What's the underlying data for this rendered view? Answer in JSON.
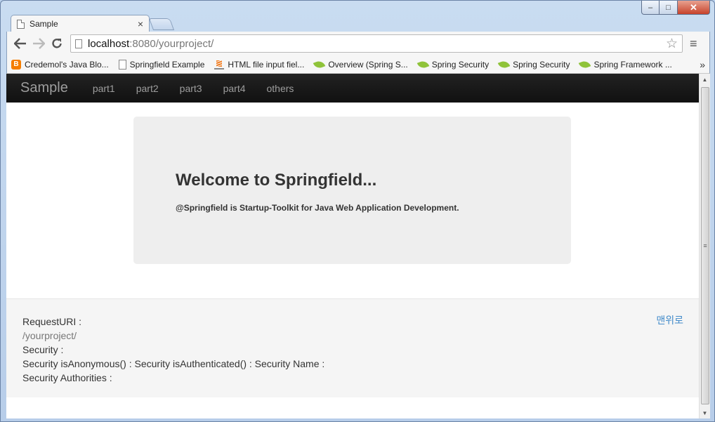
{
  "browser": {
    "tab_title": "Sample",
    "tab_close": "×",
    "url_host": "localhost",
    "url_rest": ":8080/yourproject/",
    "bookmarks": [
      {
        "icon": "blogger-icon",
        "label": "Credemol's Java Blo..."
      },
      {
        "icon": "page-icon",
        "label": "Springfield Example"
      },
      {
        "icon": "stackoverflow-icon",
        "label": "HTML file input fiel..."
      },
      {
        "icon": "spring-leaf-icon",
        "label": "Overview (Spring S..."
      },
      {
        "icon": "spring-leaf-icon",
        "label": "Spring Security"
      },
      {
        "icon": "spring-leaf-icon",
        "label": "Spring Security"
      },
      {
        "icon": "spring-leaf-icon",
        "label": "Spring Framework ..."
      }
    ],
    "bookmarks_more": "»"
  },
  "navbar": {
    "brand": "Sample",
    "links": [
      "part1",
      "part2",
      "part3",
      "part4",
      "others"
    ]
  },
  "jumbotron": {
    "title": "Welcome to Springfield...",
    "subtitle": "@Springfield is Startup-Toolkit for Java Web Application Development."
  },
  "footer": {
    "request_uri_label": "RequestURI :",
    "request_uri_value": "/yourproject/",
    "security_label": "Security :",
    "security_status": "Security isAnonymous() : Security isAuthenticated() : Security Name :",
    "security_authorities": "Security Authorities :",
    "to_top": "맨위로"
  },
  "colors": {
    "navbar_bg": "#111111",
    "link_blue": "#428bca",
    "jumbotron_bg": "#eeeeee"
  }
}
